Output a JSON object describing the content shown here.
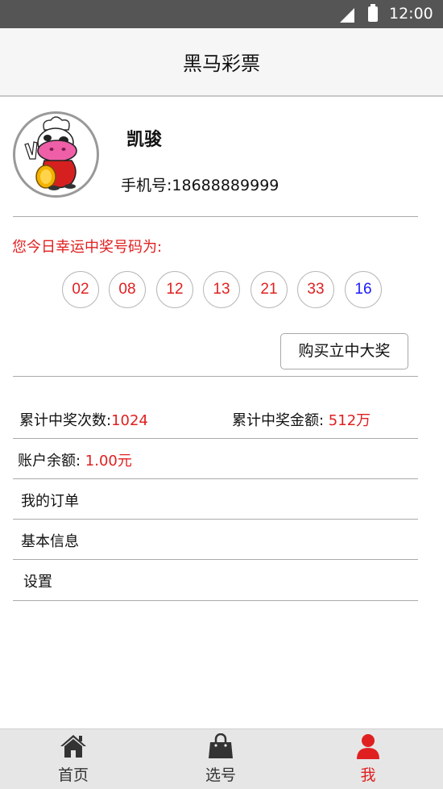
{
  "status_bar": {
    "time": "12:00"
  },
  "header": {
    "title": "黑马彩票"
  },
  "profile": {
    "name": "凯骏",
    "phone_label": "手机号:",
    "phone": "18688889999"
  },
  "lucky": {
    "label": "您今日幸运中奖号码为:",
    "red_balls": [
      "02",
      "08",
      "12",
      "13",
      "21",
      "33"
    ],
    "blue_ball": "16",
    "colors": {
      "red": "#e02020",
      "blue": "#1a1aff"
    }
  },
  "buy_button": "购买立中大奖",
  "stats": {
    "win_count_label": "累计中奖次数:",
    "win_count": "1024",
    "win_amount_label": "累计中奖金额: ",
    "win_amount": "512万",
    "balance_label": "账户余额: ",
    "balance": "1.00元"
  },
  "menu": {
    "orders": "我的订单",
    "basic_info": "基本信息",
    "settings": "设置"
  },
  "bottom_nav": {
    "items": [
      {
        "label": "首页",
        "icon": "home-icon"
      },
      {
        "label": "选号",
        "icon": "shopping-bag-icon"
      },
      {
        "label": "我",
        "icon": "user-icon",
        "active": true
      }
    ],
    "active_color": "#e02020"
  }
}
